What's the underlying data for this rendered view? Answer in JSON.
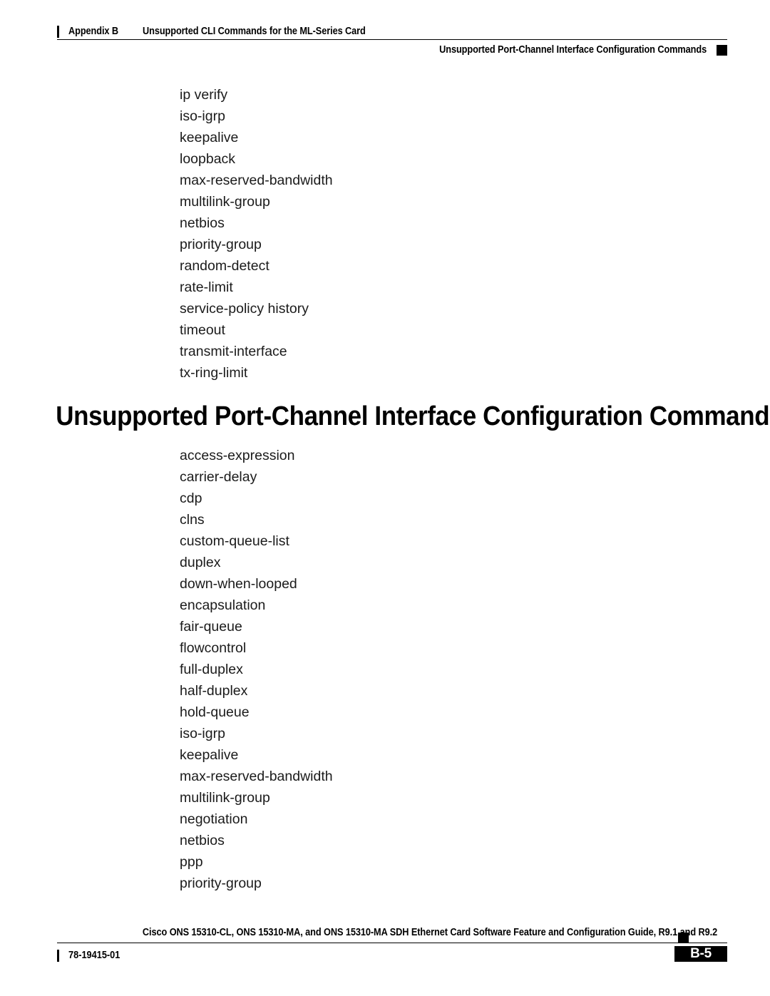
{
  "header": {
    "chapter_label": "Appendix B",
    "chapter_title": "Unsupported CLI Commands for the ML-Series Card",
    "section_title": "Unsupported Port-Channel Interface Configuration Commands"
  },
  "content": {
    "top_command_list": [
      "ip verify",
      "iso-igrp",
      "keepalive",
      "loopback",
      "max-reserved-bandwidth",
      "multilink-group",
      "netbios",
      "priority-group",
      "random-detect",
      "rate-limit",
      "service-policy history",
      "timeout",
      "transmit-interface",
      "tx-ring-limit"
    ],
    "section_heading": "Unsupported Port-Channel Interface Configuration Commands",
    "bottom_command_list": [
      "access-expression",
      "carrier-delay",
      "cdp",
      "clns",
      "custom-queue-list",
      "duplex",
      "down-when-looped",
      "encapsulation",
      "fair-queue",
      "flowcontrol",
      "full-duplex",
      "half-duplex",
      "hold-queue",
      "iso-igrp",
      "keepalive",
      "max-reserved-bandwidth",
      "multilink-group",
      "negotiation",
      "netbios",
      "ppp",
      "priority-group"
    ]
  },
  "footer": {
    "document_title": "Cisco ONS 15310-CL, ONS 15310-MA, and ONS 15310-MA SDH Ethernet Card Software Feature and Configuration Guide, R9.1 and R9.2",
    "document_number": "78-19415-01",
    "page_number": "B-5"
  },
  "colors": {
    "ink": "#000000",
    "body_text": "#1b1b1b",
    "paper": "#ffffff"
  }
}
